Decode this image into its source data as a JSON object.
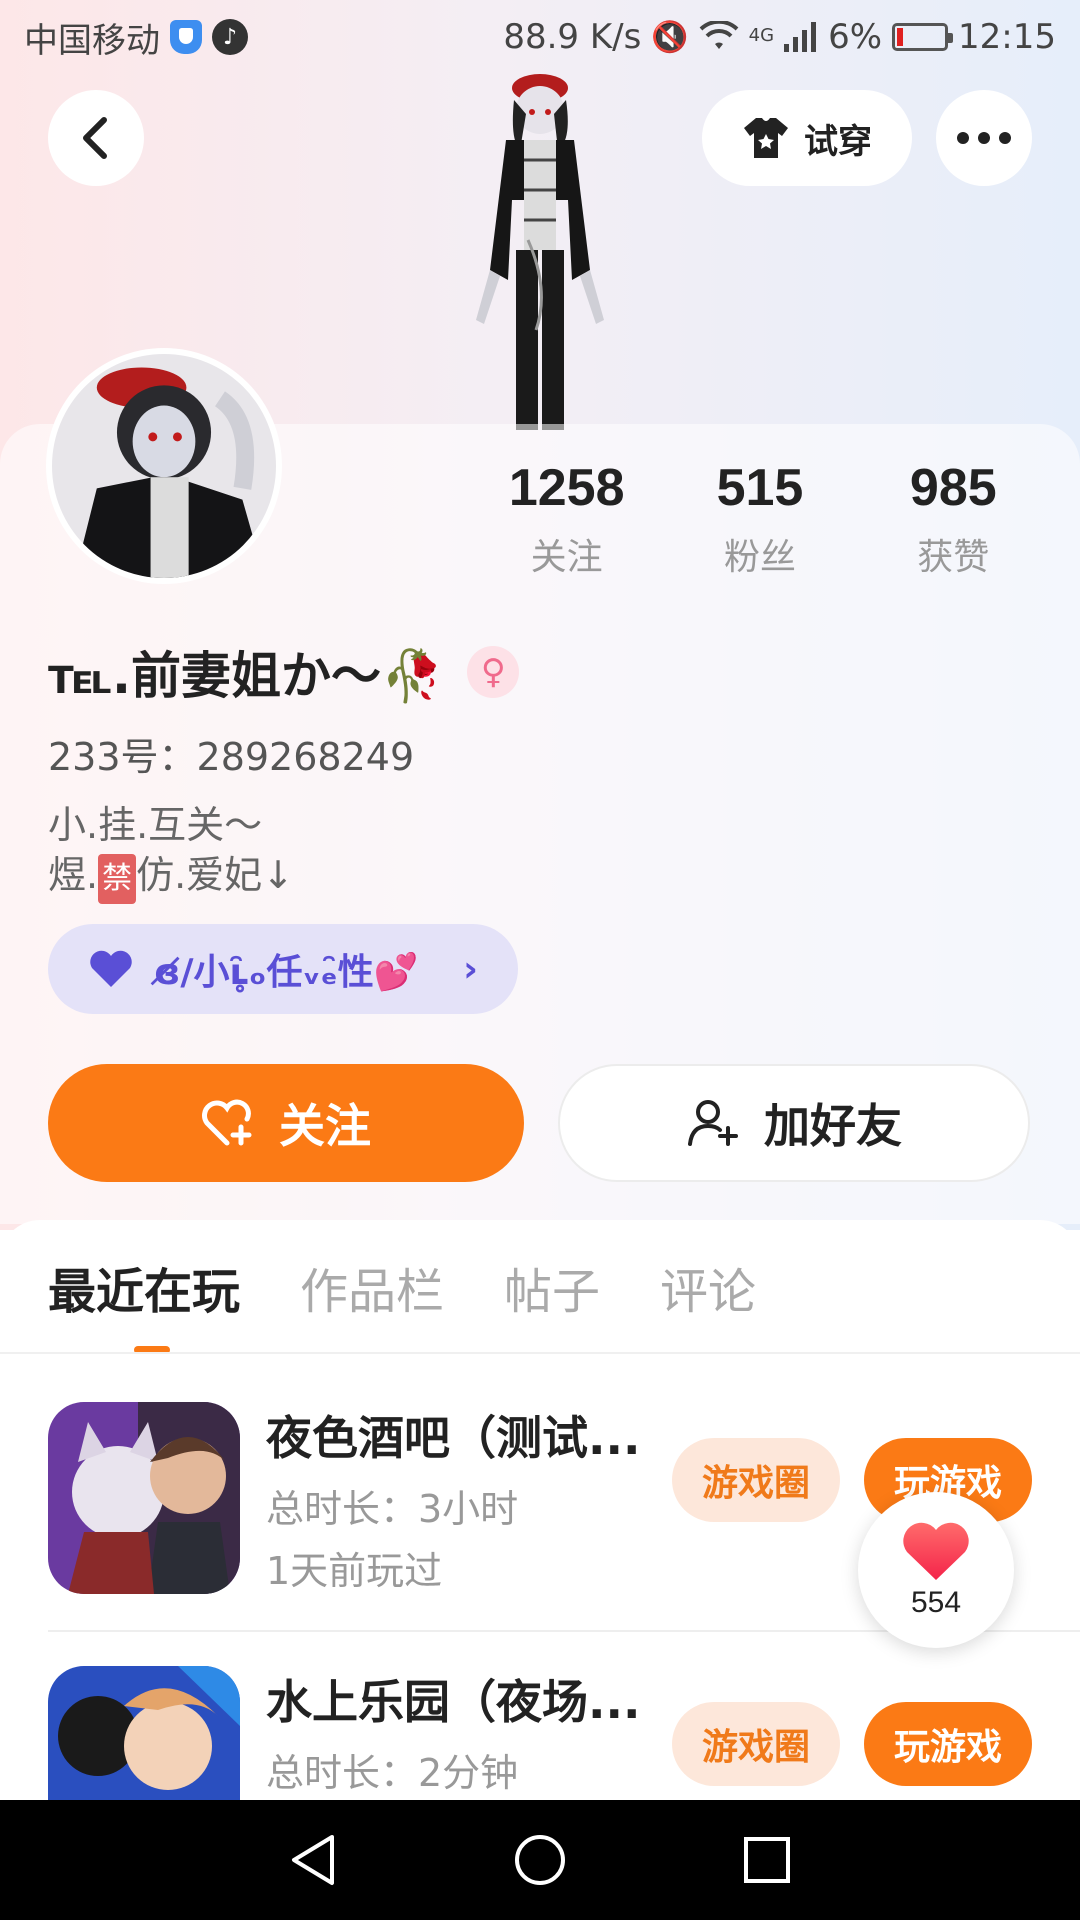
{
  "status_bar": {
    "carrier": "中国移动",
    "speed": "88.9 K/s",
    "network": "4G",
    "battery": "6%",
    "time": "12:15"
  },
  "top_bar": {
    "tryon_label": "试穿"
  },
  "profile": {
    "stats": [
      {
        "value": "1258",
        "label": "关注"
      },
      {
        "value": "515",
        "label": "粉丝"
      },
      {
        "value": "985",
        "label": "获赞"
      }
    ],
    "name": "℡.前妻姐か～🥀",
    "gender_symbol": "♀",
    "uid": "233号：289268249",
    "bio_line1": "小.挂.互关～",
    "bio_line2_prefix": "煜.",
    "bio_line2_box": "禁",
    "bio_line2_suffix": "仿.爱妃↓",
    "tag_label": "ɞ̸/小ʟ̥̑ₒ任ᵥₑ̑性💕",
    "follow_label": "关注",
    "add_friend_label": "加好友"
  },
  "tabs": [
    {
      "label": "最近在玩",
      "active": true
    },
    {
      "label": "作品栏",
      "active": false
    },
    {
      "label": "帖子",
      "active": false
    },
    {
      "label": "评论",
      "active": false
    }
  ],
  "games": [
    {
      "title": "夜色酒吧（测试...",
      "duration": "总时长：3小时",
      "last_played": "1天前玩过",
      "circle_label": "游戏圈",
      "play_label": "玩游戏"
    },
    {
      "title": "水上乐园（夜场...",
      "duration": "总时长：2分钟",
      "circle_label": "游戏圈",
      "play_label": "玩游戏"
    }
  ],
  "like_bubble": {
    "count": "554"
  },
  "colors": {
    "accent": "#fb7a15",
    "chip_bg": "#fde7da",
    "tag_bg": "#e4e2f8",
    "tag_text": "#5a4fd6"
  }
}
